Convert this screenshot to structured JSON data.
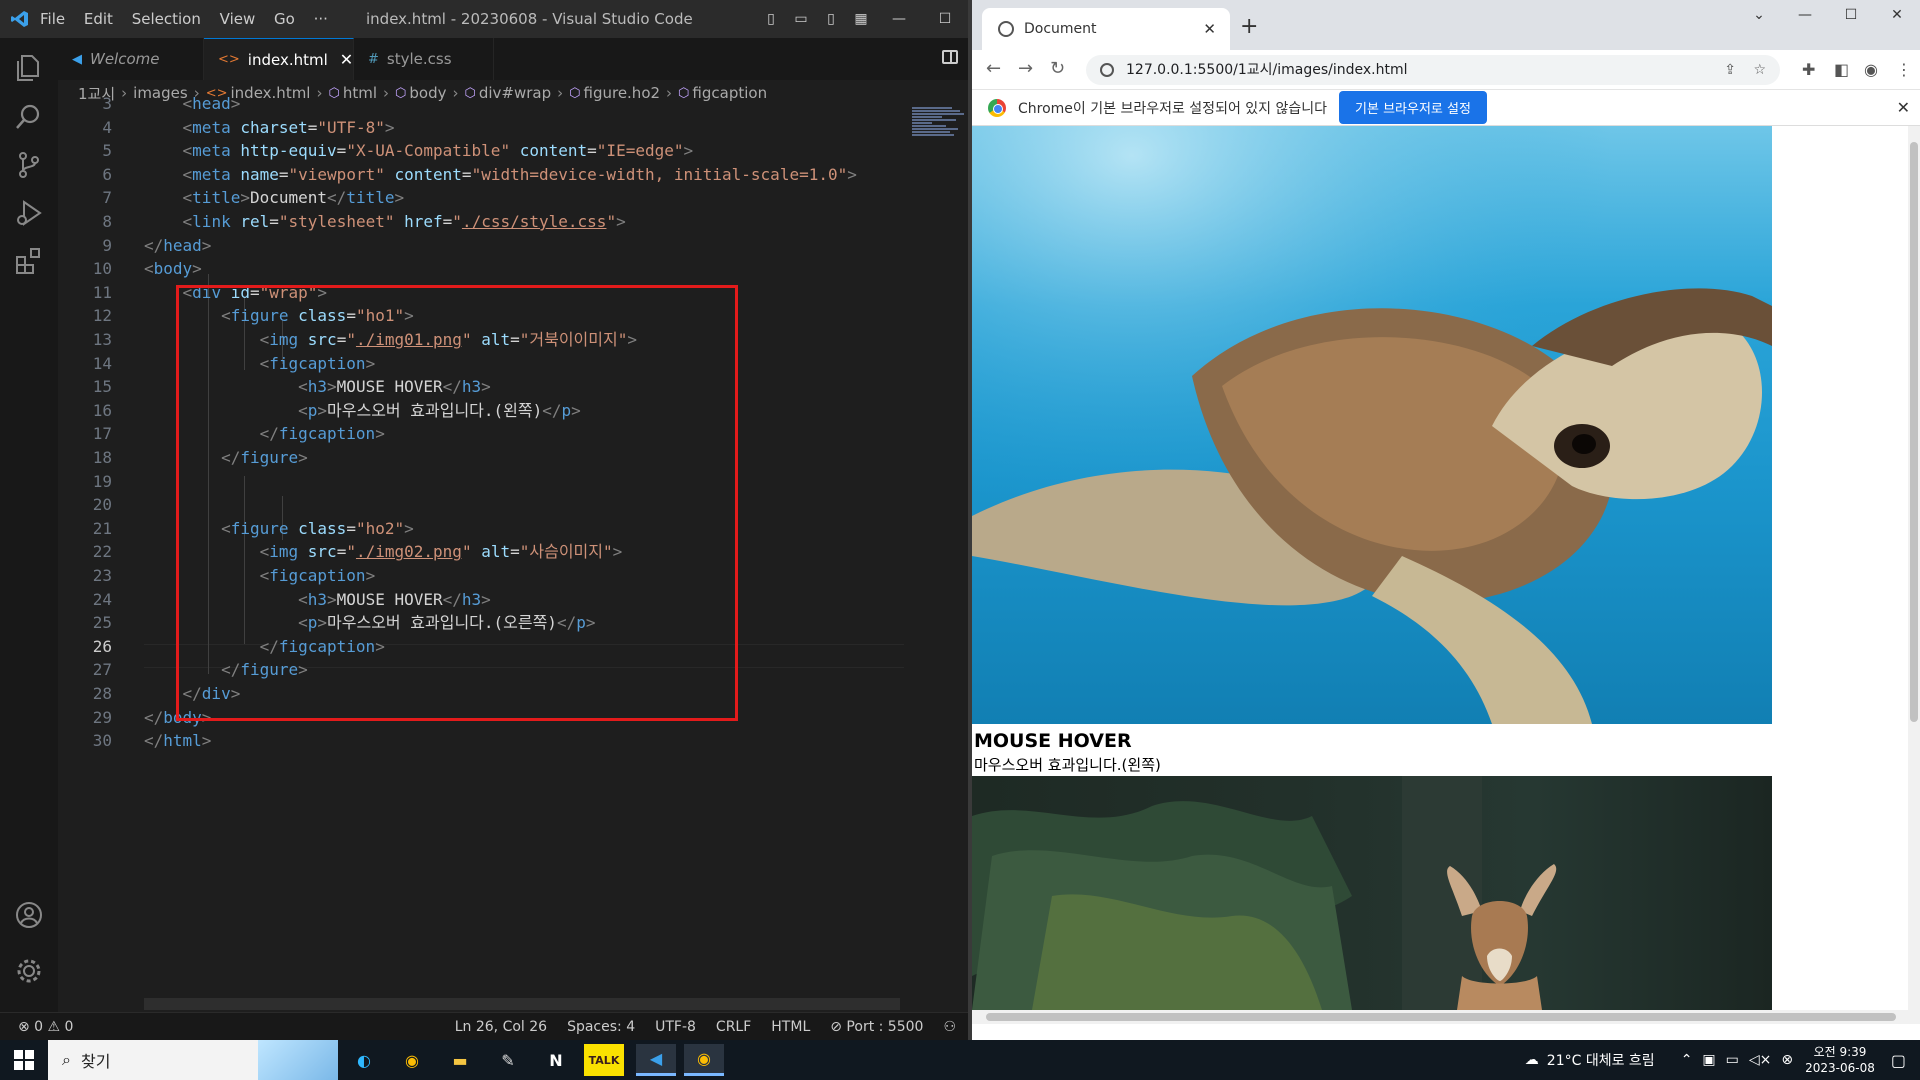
{
  "vscode": {
    "menu": [
      "File",
      "Edit",
      "Selection",
      "View",
      "Go",
      "···"
    ],
    "window_title": "index.html - 20230608 - Visual Studio Code",
    "tabs": [
      {
        "label": "Welcome",
        "icon": "vscode-icon",
        "italic": true
      },
      {
        "label": "index.html",
        "icon": "html-icon",
        "active": true
      },
      {
        "label": "style.css",
        "icon": "css-hash-icon"
      }
    ],
    "breadcrumb": [
      "1교시",
      "images",
      "index.html",
      "html",
      "body",
      "div#wrap",
      "figure.ho2",
      "figcaption"
    ],
    "current_line": 26,
    "lines": [
      {
        "n": "3",
        "tokens": [
          [
            "br",
            "    <"
          ],
          [
            "tag",
            "head"
          ],
          [
            "br",
            ">"
          ]
        ]
      },
      {
        "n": "4",
        "tokens": [
          [
            "txt",
            "    "
          ],
          [
            "br",
            "<"
          ],
          [
            "tag",
            "meta"
          ],
          [
            "txt",
            " "
          ],
          [
            "attr",
            "charset"
          ],
          [
            "txt",
            "="
          ],
          [
            "str",
            "\"UTF-8\""
          ],
          [
            "br",
            ">"
          ]
        ]
      },
      {
        "n": "5",
        "tokens": [
          [
            "txt",
            "    "
          ],
          [
            "br",
            "<"
          ],
          [
            "tag",
            "meta"
          ],
          [
            "txt",
            " "
          ],
          [
            "attr",
            "http-equiv"
          ],
          [
            "txt",
            "="
          ],
          [
            "str",
            "\"X-UA-Compatible\""
          ],
          [
            "txt",
            " "
          ],
          [
            "attr",
            "content"
          ],
          [
            "txt",
            "="
          ],
          [
            "str",
            "\"IE=edge\""
          ],
          [
            "br",
            ">"
          ]
        ]
      },
      {
        "n": "6",
        "tokens": [
          [
            "txt",
            "    "
          ],
          [
            "br",
            "<"
          ],
          [
            "tag",
            "meta"
          ],
          [
            "txt",
            " "
          ],
          [
            "attr",
            "name"
          ],
          [
            "txt",
            "="
          ],
          [
            "str",
            "\"viewport\""
          ],
          [
            "txt",
            " "
          ],
          [
            "attr",
            "content"
          ],
          [
            "txt",
            "="
          ],
          [
            "str",
            "\"width=device-width, initial-scale=1.0\""
          ],
          [
            "br",
            ">"
          ]
        ]
      },
      {
        "n": "7",
        "tokens": [
          [
            "txt",
            "    "
          ],
          [
            "br",
            "<"
          ],
          [
            "tag",
            "title"
          ],
          [
            "br",
            ">"
          ],
          [
            "txt",
            "Document"
          ],
          [
            "br",
            "</"
          ],
          [
            "tag",
            "title"
          ],
          [
            "br",
            ">"
          ]
        ]
      },
      {
        "n": "8",
        "tokens": [
          [
            "txt",
            "    "
          ],
          [
            "br",
            "<"
          ],
          [
            "tag",
            "link"
          ],
          [
            "txt",
            " "
          ],
          [
            "attr",
            "rel"
          ],
          [
            "txt",
            "="
          ],
          [
            "str",
            "\"stylesheet\""
          ],
          [
            "txt",
            " "
          ],
          [
            "attr",
            "href"
          ],
          [
            "txt",
            "="
          ],
          [
            "str",
            "\""
          ],
          [
            "stru",
            "./css/style.css"
          ],
          [
            "str",
            "\""
          ],
          [
            "br",
            ">"
          ]
        ]
      },
      {
        "n": "9",
        "tokens": [
          [
            "br",
            "</"
          ],
          [
            "tag",
            "head"
          ],
          [
            "br",
            ">"
          ]
        ]
      },
      {
        "n": "10",
        "tokens": [
          [
            "br",
            "<"
          ],
          [
            "tag",
            "body"
          ],
          [
            "br",
            ">"
          ]
        ]
      },
      {
        "n": "11",
        "tokens": [
          [
            "txt",
            "    "
          ],
          [
            "br",
            "<"
          ],
          [
            "tag",
            "div"
          ],
          [
            "txt",
            " "
          ],
          [
            "attr",
            "id"
          ],
          [
            "txt",
            "="
          ],
          [
            "str",
            "\"wrap\""
          ],
          [
            "br",
            ">"
          ]
        ]
      },
      {
        "n": "12",
        "tokens": [
          [
            "txt",
            "        "
          ],
          [
            "br",
            "<"
          ],
          [
            "tag",
            "figure"
          ],
          [
            "txt",
            " "
          ],
          [
            "attr",
            "class"
          ],
          [
            "txt",
            "="
          ],
          [
            "str",
            "\"ho1\""
          ],
          [
            "br",
            ">"
          ]
        ]
      },
      {
        "n": "13",
        "tokens": [
          [
            "txt",
            "            "
          ],
          [
            "br",
            "<"
          ],
          [
            "tag",
            "img"
          ],
          [
            "txt",
            " "
          ],
          [
            "attr",
            "src"
          ],
          [
            "txt",
            "="
          ],
          [
            "str",
            "\""
          ],
          [
            "stru",
            "./img01.png"
          ],
          [
            "str",
            "\""
          ],
          [
            "txt",
            " "
          ],
          [
            "attr",
            "alt"
          ],
          [
            "txt",
            "="
          ],
          [
            "str",
            "\"거북이이미지\""
          ],
          [
            "br",
            ">"
          ]
        ]
      },
      {
        "n": "14",
        "tokens": [
          [
            "txt",
            "            "
          ],
          [
            "br",
            "<"
          ],
          [
            "tag",
            "figcaption"
          ],
          [
            "br",
            ">"
          ]
        ]
      },
      {
        "n": "15",
        "tokens": [
          [
            "txt",
            "                "
          ],
          [
            "br",
            "<"
          ],
          [
            "tag",
            "h3"
          ],
          [
            "br",
            ">"
          ],
          [
            "txt",
            "MOUSE HOVER"
          ],
          [
            "br",
            "</"
          ],
          [
            "tag",
            "h3"
          ],
          [
            "br",
            ">"
          ]
        ]
      },
      {
        "n": "16",
        "tokens": [
          [
            "txt",
            "                "
          ],
          [
            "br",
            "<"
          ],
          [
            "tag",
            "p"
          ],
          [
            "br",
            ">"
          ],
          [
            "txt",
            "마우스오버 효과입니다.(왼쪽)"
          ],
          [
            "br",
            "</"
          ],
          [
            "tag",
            "p"
          ],
          [
            "br",
            ">"
          ]
        ]
      },
      {
        "n": "17",
        "tokens": [
          [
            "txt",
            "            "
          ],
          [
            "br",
            "</"
          ],
          [
            "tag",
            "figcaption"
          ],
          [
            "br",
            ">"
          ]
        ]
      },
      {
        "n": "18",
        "tokens": [
          [
            "txt",
            "        "
          ],
          [
            "br",
            "</"
          ],
          [
            "tag",
            "figure"
          ],
          [
            "br",
            ">"
          ]
        ]
      },
      {
        "n": "19",
        "tokens": []
      },
      {
        "n": "20",
        "tokens": []
      },
      {
        "n": "21",
        "tokens": [
          [
            "txt",
            "        "
          ],
          [
            "br",
            "<"
          ],
          [
            "tag",
            "figure"
          ],
          [
            "txt",
            " "
          ],
          [
            "attr",
            "class"
          ],
          [
            "txt",
            "="
          ],
          [
            "str",
            "\"ho2\""
          ],
          [
            "br",
            ">"
          ]
        ]
      },
      {
        "n": "22",
        "tokens": [
          [
            "txt",
            "            "
          ],
          [
            "br",
            "<"
          ],
          [
            "tag",
            "img"
          ],
          [
            "txt",
            " "
          ],
          [
            "attr",
            "src"
          ],
          [
            "txt",
            "="
          ],
          [
            "str",
            "\""
          ],
          [
            "stru",
            "./img02.png"
          ],
          [
            "str",
            "\""
          ],
          [
            "txt",
            " "
          ],
          [
            "attr",
            "alt"
          ],
          [
            "txt",
            "="
          ],
          [
            "str",
            "\"사슴이미지\""
          ],
          [
            "br",
            ">"
          ]
        ]
      },
      {
        "n": "23",
        "tokens": [
          [
            "txt",
            "            "
          ],
          [
            "br",
            "<"
          ],
          [
            "tag",
            "figcaption"
          ],
          [
            "br",
            ">"
          ]
        ]
      },
      {
        "n": "24",
        "tokens": [
          [
            "txt",
            "                "
          ],
          [
            "br",
            "<"
          ],
          [
            "tag",
            "h3"
          ],
          [
            "br",
            ">"
          ],
          [
            "txt",
            "MOUSE HOVER"
          ],
          [
            "br",
            "</"
          ],
          [
            "tag",
            "h3"
          ],
          [
            "br",
            ">"
          ]
        ]
      },
      {
        "n": "25",
        "tokens": [
          [
            "txt",
            "                "
          ],
          [
            "br",
            "<"
          ],
          [
            "tag",
            "p"
          ],
          [
            "br",
            ">"
          ],
          [
            "txt",
            "마우스오버 효과입니다.(오른쪽)"
          ],
          [
            "br",
            "</"
          ],
          [
            "tag",
            "p"
          ],
          [
            "br",
            ">"
          ]
        ]
      },
      {
        "n": "26",
        "tokens": [
          [
            "txt",
            "            "
          ],
          [
            "br",
            "</"
          ],
          [
            "tag",
            "figcaption"
          ],
          [
            "br",
            ">"
          ]
        ]
      },
      {
        "n": "27",
        "tokens": [
          [
            "txt",
            "        "
          ],
          [
            "br",
            "</"
          ],
          [
            "tag",
            "figure"
          ],
          [
            "br",
            ">"
          ]
        ]
      },
      {
        "n": "28",
        "tokens": [
          [
            "txt",
            "    "
          ],
          [
            "br",
            "</"
          ],
          [
            "tag",
            "div"
          ],
          [
            "br",
            ">"
          ]
        ]
      },
      {
        "n": "29",
        "tokens": [
          [
            "br",
            "</"
          ],
          [
            "tag",
            "body"
          ],
          [
            "br",
            ">"
          ]
        ]
      },
      {
        "n": "30",
        "tokens": [
          [
            "br",
            "</"
          ],
          [
            "tag",
            "html"
          ],
          [
            "br",
            ">"
          ]
        ]
      }
    ],
    "status": {
      "problems": "⊗ 0 ⚠ 0",
      "position": "Ln 26, Col 26",
      "spaces": "Spaces: 4",
      "encoding": "UTF-8",
      "eol": "CRLF",
      "language": "HTML",
      "port": "⊘ Port : 5500"
    }
  },
  "chrome": {
    "tab_title": "Document",
    "url": "127.0.0.1:5500/1교시/images/index.html",
    "infobar_text": "Chrome이 기본 브라우저로 설정되어 있지 않습니다",
    "infobar_button": "기본 브라우저로 설정",
    "page": {
      "caption1_h3": "MOUSE HOVER",
      "caption1_p": "마우스오버 효과입니다.(왼쪽)"
    }
  },
  "taskbar": {
    "search_placeholder": "찾기",
    "weather": "21°C 대체로 흐림",
    "time": "오전 9:39",
    "date": "2023-06-08"
  },
  "colors": {
    "tag": "#569cd6",
    "attr": "#9cdcfe",
    "string": "#ce9178",
    "highlight_box": "#e31b1b",
    "chrome_button": "#1a73e8"
  }
}
